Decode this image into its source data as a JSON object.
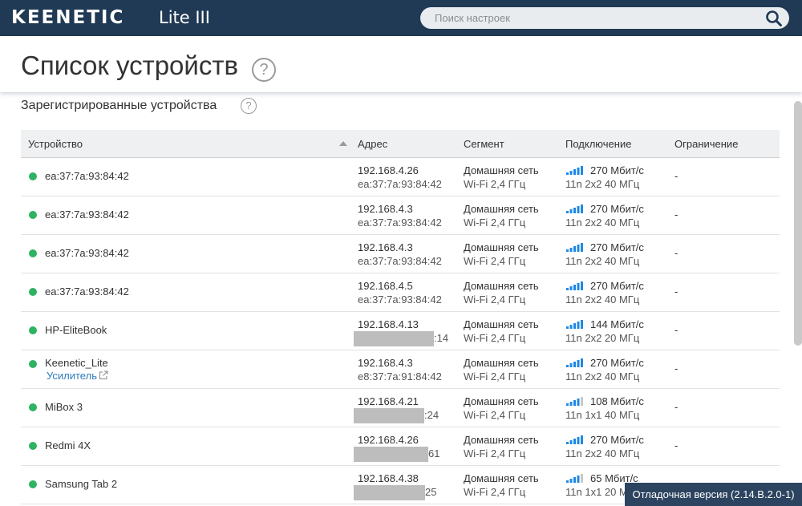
{
  "header": {
    "logo": "KEENETIC",
    "model": "Lite III",
    "search_placeholder": "Поиск настроек"
  },
  "page": {
    "title": "Список устройств",
    "help": "?",
    "section_title": "Зарегистрированные устройства"
  },
  "table": {
    "columns": [
      "Устройство",
      "Адрес",
      "Сегмент",
      "Подключение",
      "Ограничение"
    ],
    "rows": [
      {
        "name": "ea:37:7a:93:84:42",
        "ip": "192.168.4.26",
        "mac": "ea:37:7a:93:84:42",
        "segment": "Домашняя сеть",
        "band": "Wi-Fi 2,4 ГГц",
        "speed": "270 Мбит/с",
        "mode": "11n 2x2 40 МГц",
        "signal": 5,
        "limit": "-"
      },
      {
        "name": "ea:37:7a:93:84:42",
        "ip": "192.168.4.3",
        "mac": "ea:37:7a:93:84:42",
        "segment": "Домашняя сеть",
        "band": "Wi-Fi 2,4 ГГц",
        "speed": "270 Мбит/с",
        "mode": "11n 2x2 40 МГц",
        "signal": 5,
        "limit": "-"
      },
      {
        "name": "ea:37:7a:93:84:42",
        "ip": "192.168.4.3",
        "mac": "ea:37:7a:93:84:42",
        "segment": "Домашняя сеть",
        "band": "Wi-Fi 2,4 ГГц",
        "speed": "270 Мбит/с",
        "mode": "11n 2x2 40 МГц",
        "signal": 5,
        "limit": "-"
      },
      {
        "name": "ea:37:7a:93:84:42",
        "ip": "192.168.4.5",
        "mac": "ea:37:7a:93:84:42",
        "segment": "Домашняя сеть",
        "band": "Wi-Fi 2,4 ГГц",
        "speed": "270 Мбит/с",
        "mode": "11n 2x2 40 МГц",
        "signal": 5,
        "limit": "-"
      },
      {
        "name": "HP-EliteBook",
        "ip": "192.168.4.13",
        "mac": ":14",
        "segment": "Домашняя сеть",
        "band": "Wi-Fi 2,4 ГГц",
        "speed": "144 Мбит/с",
        "mode": "11n 2x2 20 МГц",
        "signal": 5,
        "limit": "-"
      },
      {
        "name": "Keenetic_Lite",
        "sub": "Усилитель",
        "ip": "192.168.4.3",
        "mac": "e8:37:7a:91:84:42",
        "segment": "Домашняя сеть",
        "band": "Wi-Fi 2,4 ГГц",
        "speed": "270 Мбит/с",
        "mode": "11n 2x2 40 МГц",
        "signal": 5,
        "limit": "-"
      },
      {
        "name": "MiBox 3",
        "ip": "192.168.4.21",
        "mac": ":24",
        "segment": "Домашняя сеть",
        "band": "Wi-Fi 2,4 ГГц",
        "speed": "108 Мбит/с",
        "mode": "11n 1x1 40 МГц",
        "signal": 4,
        "limit": "-"
      },
      {
        "name": "Redmi 4X",
        "ip": "192.168.4.26",
        "mac": "61",
        "segment": "Домашняя сеть",
        "band": "Wi-Fi 2,4 ГГц",
        "speed": "270 Мбит/с",
        "mode": "11n 2x2 40 МГц",
        "signal": 5,
        "limit": "-"
      },
      {
        "name": "Samsung Tab 2",
        "ip": "192.168.4.38",
        "mac": "25",
        "segment": "Домашняя сеть",
        "band": "Wi-Fi 2,4 ГГц",
        "speed": "65 Мбит/с",
        "mode": "11n 1x1 20 МГц",
        "signal": 4,
        "limit": "-"
      }
    ]
  },
  "footer": {
    "debug": "Отладочная версия (2.14.В.2.0-1)"
  },
  "colors": {
    "topbar": "#203a55",
    "online_dot": "#2eb362",
    "signal_on": "#1e88e5",
    "signal_off": "#c8c8c8",
    "link": "#2e7bbd"
  }
}
